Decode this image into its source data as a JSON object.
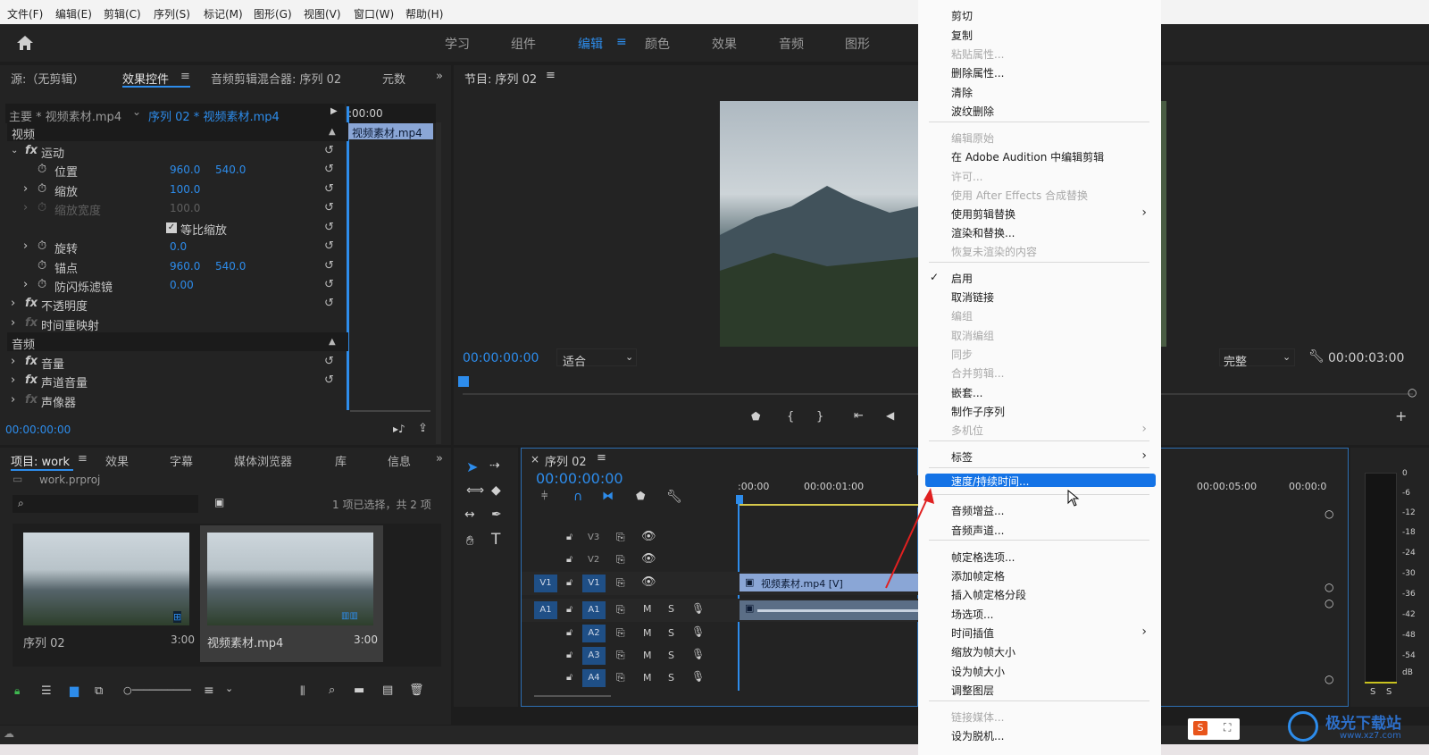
{
  "menubar": [
    "文件(F)",
    "编辑(E)",
    "剪辑(C)",
    "序列(S)",
    "标记(M)",
    "图形(G)",
    "视图(V)",
    "窗口(W)",
    "帮助(H)"
  ],
  "workspaces": [
    "学习",
    "组件",
    "编辑",
    "颜色",
    "效果",
    "音频",
    "图形"
  ],
  "active_workspace": "编辑",
  "source_panel": {
    "tabs": [
      "源:（无剪辑）",
      "效果控件",
      "音频剪辑混合器: 序列 02",
      "元数"
    ],
    "active_tab": "效果控件",
    "master_clip": "主要 * 视频素材.mp4",
    "seq_clip": "序列 02 * 视频素材.mp4",
    "time_ruler": ":00:00",
    "clip_bar": "视频素材.mp4",
    "video_header": "视频",
    "motion": "运动",
    "props": [
      {
        "name": "位置",
        "v1": "960.0",
        "v2": "540.0"
      },
      {
        "name": "缩放",
        "v1": "100.0",
        "v2": ""
      },
      {
        "name": "缩放宽度",
        "v1": "100.0",
        "v2": ""
      },
      {
        "name": "等比缩放",
        "v1": "",
        "v2": ""
      },
      {
        "name": "旋转",
        "v1": "0.0",
        "v2": ""
      },
      {
        "name": "锚点",
        "v1": "960.0",
        "v2": "540.0"
      },
      {
        "name": "防闪烁滤镜",
        "v1": "0.00",
        "v2": ""
      }
    ],
    "opacity": "不透明度",
    "time_remap": "时间重映射",
    "audio_header": "音频",
    "volume": "音量",
    "channel_volume": "声道音量",
    "panner": "声像器",
    "timecode": "00:00:00:00"
  },
  "program": {
    "title": "节目: 序列 02",
    "timecode": "00:00:00:00",
    "fit": "适合",
    "quality": "完整",
    "duration": "00:00:03:00"
  },
  "project": {
    "tabs": [
      "项目: work",
      "效果",
      "字幕",
      "媒体浏览器",
      "库",
      "信息"
    ],
    "file": "work.prproj",
    "selection": "1 项已选择，共 2 项",
    "items": [
      {
        "name": "序列 02",
        "duration": "3:00"
      },
      {
        "name": "视频素材.mp4",
        "duration": "3:00"
      }
    ]
  },
  "timeline": {
    "title": "序列 02",
    "timecode": "00:00:00:00",
    "ruler": [
      ":00:00",
      "00:00:01:00",
      "00:00:05:00",
      "00:00:0"
    ],
    "tracks_v": [
      "V3",
      "V2",
      "V1"
    ],
    "tracks_a": [
      "A1",
      "A2",
      "A3",
      "A4"
    ],
    "clip_label": "视频素材.mp4 [V]"
  },
  "meter_scale": [
    "0",
    "-6",
    "-12",
    "-18",
    "-24",
    "-30",
    "-36",
    "-42",
    "-48",
    "-54",
    "dB"
  ],
  "meter_solo": [
    "S",
    "S"
  ],
  "context_menu": {
    "groups": [
      [
        {
          "label": "剪切",
          "enabled": true
        },
        {
          "label": "复制",
          "enabled": true
        },
        {
          "label": "粘贴属性...",
          "enabled": false
        },
        {
          "label": "删除属性...",
          "enabled": true
        },
        {
          "label": "清除",
          "enabled": true
        },
        {
          "label": "波纹删除",
          "enabled": true
        }
      ],
      [
        {
          "label": "编辑原始",
          "enabled": false
        },
        {
          "label": "在 Adobe Audition 中编辑剪辑",
          "enabled": true
        },
        {
          "label": "许可...",
          "enabled": false
        },
        {
          "label": "使用 After Effects 合成替换",
          "enabled": false
        },
        {
          "label": "使用剪辑替换",
          "enabled": true,
          "submenu": true
        },
        {
          "label": "渲染和替换...",
          "enabled": true
        },
        {
          "label": "恢复未渲染的内容",
          "enabled": false
        }
      ],
      [
        {
          "label": "启用",
          "enabled": true,
          "checked": true
        },
        {
          "label": "取消链接",
          "enabled": true
        },
        {
          "label": "编组",
          "enabled": false
        },
        {
          "label": "取消编组",
          "enabled": false
        },
        {
          "label": "同步",
          "enabled": false
        },
        {
          "label": "合并剪辑...",
          "enabled": false
        },
        {
          "label": "嵌套...",
          "enabled": true
        },
        {
          "label": "制作子序列",
          "enabled": true
        },
        {
          "label": "多机位",
          "enabled": false,
          "submenu": true
        }
      ],
      [
        {
          "label": "标签",
          "enabled": true,
          "submenu": true
        }
      ],
      [
        {
          "label": "速度/持续时间...",
          "enabled": true,
          "highlighted": true
        }
      ],
      [
        {
          "label": "音频增益...",
          "enabled": true
        },
        {
          "label": "音频声道...",
          "enabled": true
        }
      ],
      [
        {
          "label": "帧定格选项...",
          "enabled": true
        },
        {
          "label": "添加帧定格",
          "enabled": true
        },
        {
          "label": "插入帧定格分段",
          "enabled": true
        },
        {
          "label": "场选项...",
          "enabled": true
        },
        {
          "label": "时间插值",
          "enabled": true,
          "submenu": true
        },
        {
          "label": "缩放为帧大小",
          "enabled": true
        },
        {
          "label": "设为帧大小",
          "enabled": true
        },
        {
          "label": "调整图层",
          "enabled": true
        }
      ],
      [
        {
          "label": "链接媒体...",
          "enabled": false
        },
        {
          "label": "设为脱机...",
          "enabled": true
        }
      ]
    ]
  },
  "watermark": {
    "brand": "极光下载站",
    "url": "www.xz7.com"
  },
  "colors": {
    "accent": "#2d8ceb",
    "highlight": "#1473e6",
    "arrow": "#e02020",
    "clip_video": "#8aa6d6"
  }
}
